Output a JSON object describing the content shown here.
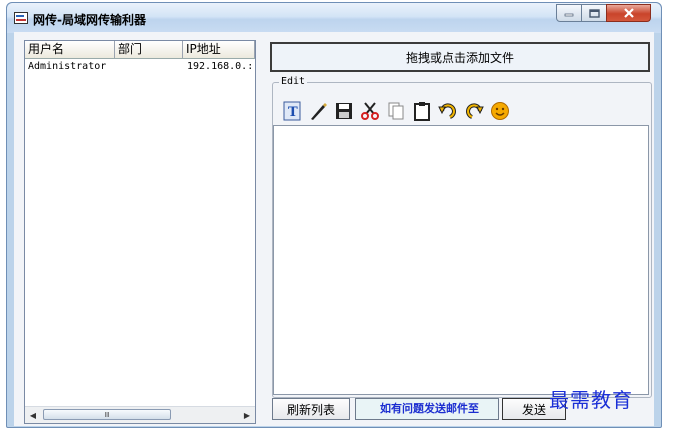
{
  "window": {
    "title": "网传-局域网传输利器"
  },
  "user_list": {
    "columns": [
      "用户名",
      "部门",
      "IP地址"
    ],
    "rows": [
      {
        "username": "Administrator",
        "department": "",
        "ip": "192.168.0.:"
      }
    ],
    "scroll_thumb_glyph": "Ⅲ"
  },
  "drop_zone": {
    "label": "拖拽或点击添加文件"
  },
  "editor": {
    "group_label": "Edit",
    "toolbar_icons": [
      "text-font-icon",
      "pen-icon",
      "save-disk-icon",
      "cut-scissors-icon",
      "copy-icon",
      "paste-icon",
      "undo-icon",
      "redo-icon",
      "emoji-smiley-icon"
    ],
    "content": ""
  },
  "footer": {
    "refresh_label": "刷新列表",
    "help_text": "如有问题发送邮件至",
    "send_label": "发送"
  },
  "watermark": "最需教育",
  "colors": {
    "help_text": "#1c2ed0",
    "watermark": "#1b2fd6",
    "titlebar": "#c9dcf2"
  }
}
